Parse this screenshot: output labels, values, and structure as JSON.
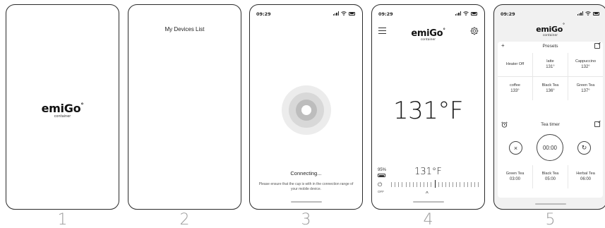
{
  "captions": [
    "1",
    "2",
    "3",
    "4",
    "5"
  ],
  "brand": {
    "name": "emiGo",
    "mark": "°",
    "sub": "container"
  },
  "status": {
    "time": "09:29"
  },
  "screen2": {
    "title": "My Devices List"
  },
  "screen3": {
    "connecting": "Connecting...",
    "message": "Please ensure that the cup is with in the connection range of your mobile device."
  },
  "screen4": {
    "current_temp": "131°F",
    "battery": "95%",
    "power_label": "OFF",
    "set_temp": "131°F"
  },
  "screen5": {
    "presets_title": "Presets",
    "presets": [
      {
        "name": "Heater Off",
        "temp": ""
      },
      {
        "name": "latte",
        "temp": "131°"
      },
      {
        "name": "Cappuccino",
        "temp": "132°"
      },
      {
        "name": "coffee",
        "temp": "133°"
      },
      {
        "name": "Black Tea",
        "temp": "136°"
      },
      {
        "name": "Green Tea",
        "temp": "137°"
      }
    ],
    "timer_title": "Tea timer",
    "timer_value": "00:00",
    "timers": [
      {
        "name": "Green Tea",
        "time": "03:00"
      },
      {
        "name": "Black Tea",
        "time": "05:00"
      },
      {
        "name": "Herbal Tea",
        "time": "06:00"
      }
    ]
  },
  "colors": {
    "frame": "#2a2a2a",
    "ripple_outer": "#ececec",
    "ripple_mid": "#d8d8d8",
    "ripple_inner": "#bdbdbd",
    "panel_bg": "#f1f1f1"
  },
  "icons": [
    "hamburger-icon",
    "gear-icon",
    "plus-icon",
    "edit-icon",
    "alarm-clock-icon",
    "close-icon",
    "refresh-icon",
    "power-icon",
    "battery-icon",
    "caret-up-icon"
  ]
}
